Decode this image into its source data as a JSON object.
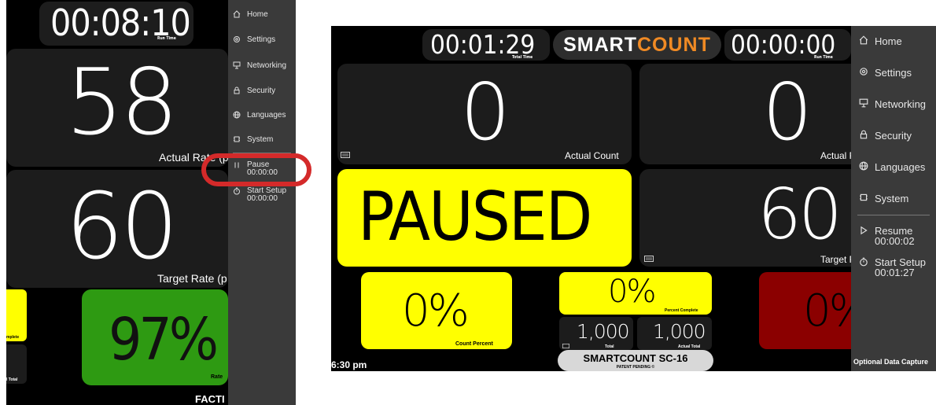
{
  "left": {
    "run_timer": "00:08:10",
    "run_timer_label": "Run Time",
    "actual_rate_value": "58",
    "actual_rate_label": "Actual Rate (p",
    "target_rate_value": "60",
    "target_rate_label": "Target Rate (p",
    "rate_percent": "97%",
    "rate_percent_label": "Rate",
    "complete_label": "mplete",
    "total_label": "l Total",
    "factory_text": "FACTI",
    "menu": [
      {
        "label": "Home",
        "icon": "home-icon"
      },
      {
        "label": "Settings",
        "icon": "gear-icon"
      },
      {
        "label": "Networking",
        "icon": "monitor-icon"
      },
      {
        "label": "Security",
        "icon": "lock-icon"
      },
      {
        "label": "Languages",
        "icon": "globe-icon"
      },
      {
        "label": "System",
        "icon": "chip-icon"
      },
      {
        "label": "Pause",
        "sub": "00:00:00",
        "icon": "pause-icon"
      },
      {
        "label": "Start Setup",
        "sub": "00:00:00",
        "icon": "timer-icon"
      }
    ]
  },
  "right": {
    "total_time": "00:01:29",
    "total_time_label": "Total Time",
    "run_time": "00:00:00",
    "run_time_label": "Run Time",
    "logo_smart": "SMART",
    "logo_count": "COUNT",
    "actual_count_value": "0",
    "actual_count_label": "Actual Count",
    "actual_rate_value": "0",
    "actual_rate_label": "Actual R",
    "paused_text": "PAUSED",
    "target_rate_value": "60",
    "target_rate_label": "Target R",
    "count_percent_value": "0%",
    "count_percent_label": "Count Percent",
    "percent_complete_value": "0%",
    "percent_complete_label": "Percent Complete",
    "total_value": "1,000",
    "total_label": "Total",
    "actual_total_value": "1,000",
    "actual_total_label": "Actual Total",
    "red_percent_value": "0%",
    "time_of_day": "6:30 pm",
    "device_name": "SMARTCOUNT SC-16",
    "patent": "PATENT PENDING ©",
    "optional_capture": "Optional Data Capture",
    "menu": [
      {
        "label": "Home",
        "icon": "home-icon"
      },
      {
        "label": "Settings",
        "icon": "gear-icon"
      },
      {
        "label": "Networking",
        "icon": "monitor-icon"
      },
      {
        "label": "Security",
        "icon": "lock-icon"
      },
      {
        "label": "Languages",
        "icon": "globe-icon"
      },
      {
        "label": "System",
        "icon": "chip-icon"
      },
      {
        "label": "Resume",
        "sub": "00:00:02",
        "icon": "play-icon"
      },
      {
        "label": "Start Setup",
        "sub": "00:01:27",
        "icon": "timer-icon"
      }
    ]
  },
  "colors": {
    "yellow": "#ffff00",
    "green": "#2e9a12",
    "red": "#8b0000",
    "orange": "#f08a24",
    "highlight": "#d42a2a",
    "panel": "#1c1c1c",
    "menu_bg": "#3a3a3a"
  }
}
